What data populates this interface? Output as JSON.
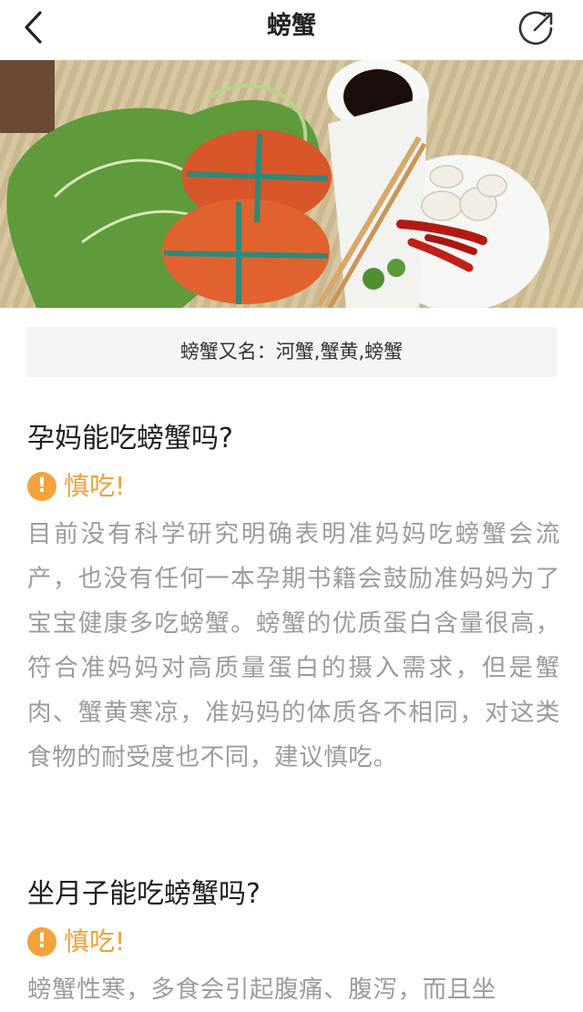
{
  "nav": {
    "title": "螃蟹",
    "back_icon": "chevron-left-icon",
    "share_icon": "share-circle-icon"
  },
  "hero_image": {
    "description_icon": "crab-dish-photo"
  },
  "alias": {
    "text": "螃蟹又名：河蟹,蟹黄,螃蟹"
  },
  "sections": [
    {
      "question": "孕妈能吃螃蟹吗?",
      "verdict": "慎吃!",
      "body": "目前没有科学研究明确表明准妈妈吃螃蟹会流产，也没有任何一本孕期书籍会鼓励准妈妈为了宝宝健康多吃螃蟹。螃蟹的优质蛋白含量很高，符合准妈妈对高质量蛋白的摄入需求，但是蟹肉、蟹黄寒凉，准妈妈的体质各不相同，对这类食物的耐受度也不同，建议慎吃。"
    },
    {
      "question": "坐月子能吃螃蟹吗?",
      "verdict": "慎吃!",
      "body": "螃蟹性寒，多食会引起腹痛、腹泻，而且坐"
    }
  ],
  "colors": {
    "accent": "#f5a23a",
    "title": "#1e1e1e",
    "body": "#9c9c9c",
    "alias_bg": "#f5f5f7"
  }
}
